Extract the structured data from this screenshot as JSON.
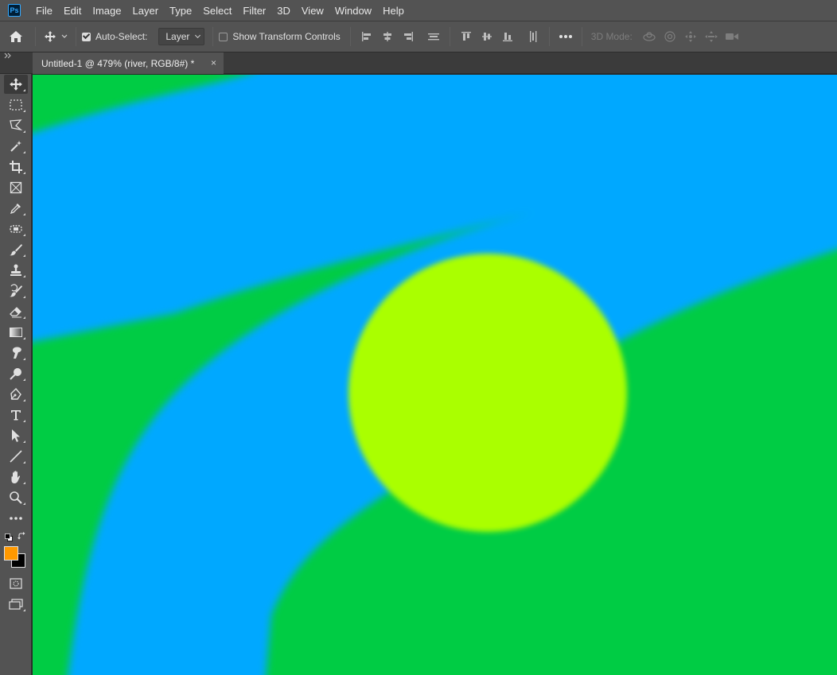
{
  "app": {
    "logo_text": "Ps"
  },
  "menu": [
    "File",
    "Edit",
    "Image",
    "Layer",
    "Type",
    "Select",
    "Filter",
    "3D",
    "View",
    "Window",
    "Help"
  ],
  "options_bar": {
    "auto_select_label": "Auto-Select:",
    "auto_select_checked": true,
    "auto_select_target": "Layer",
    "show_transform_label": "Show Transform Controls",
    "show_transform_checked": false,
    "three_d_mode_label": "3D Mode:"
  },
  "document_tab": {
    "title": "Untitled-1 @ 479% (river, RGB/8#) *",
    "close_glyph": "×"
  },
  "colors": {
    "foreground": "#ff9900",
    "background": "#000000",
    "canvas_green": "#00cc44",
    "canvas_blue": "#00a8ff",
    "canvas_circle": "#aaff00"
  },
  "tools": [
    "move-tool",
    "marquee-tool",
    "lasso-tool",
    "magic-wand-tool",
    "crop-tool",
    "frame-tool",
    "eyedropper-tool",
    "spot-healing-tool",
    "brush-tool",
    "clone-stamp-tool",
    "history-brush-tool",
    "eraser-tool",
    "gradient-tool",
    "smudge-tool",
    "dodge-tool",
    "pen-tool",
    "type-tool",
    "path-selection-tool",
    "line-tool",
    "hand-tool",
    "zoom-tool",
    "edit-toolbar",
    "quick-mask",
    "screen-mode"
  ]
}
